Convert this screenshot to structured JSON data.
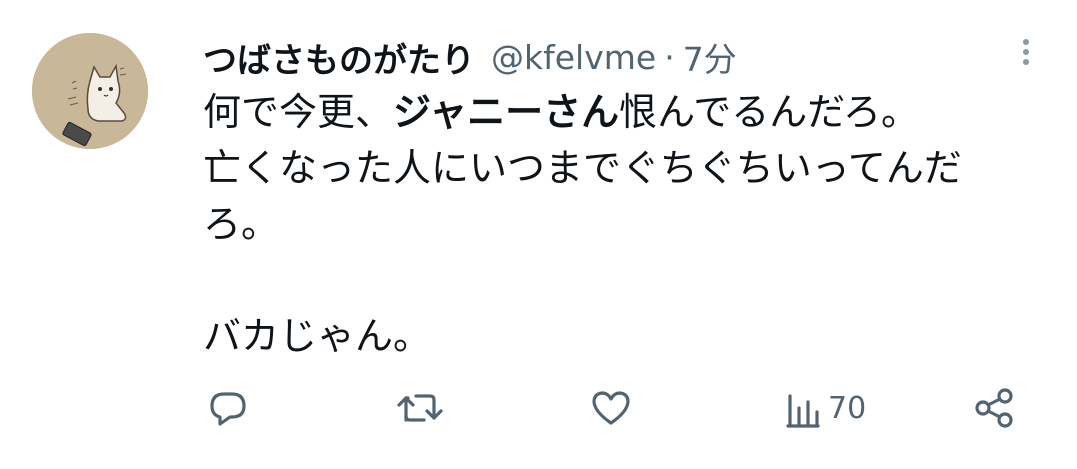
{
  "user": {
    "display_name": "つばさものがたり",
    "handle": "@kfelvme",
    "separator": "·",
    "time": "7分",
    "avatar_icon": "cat-drawing-avatar"
  },
  "tweet": {
    "line1_a": "何で今更、",
    "line1_bold": "ジャニーさん",
    "line1_b": "恨んでるんだろ。",
    "line2": "亡くなった人にいつまでぐちぐちいってんだ",
    "line3": "ろ。",
    "line5": "バカじゃん。"
  },
  "actions": {
    "reply_icon": "reply-icon",
    "retweet_icon": "retweet-icon",
    "like_icon": "like-icon",
    "views_icon": "views-icon",
    "views_count": "70",
    "share_icon": "share-icon"
  },
  "colors": {
    "text": "#0f1419",
    "secondary": "#536471",
    "avatar_bg": "#c9b79a"
  }
}
